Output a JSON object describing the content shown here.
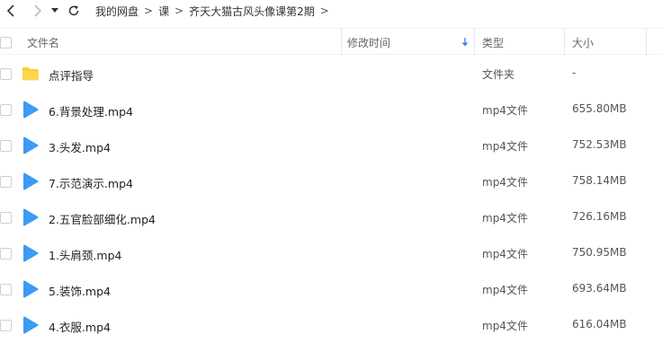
{
  "toolbar": {
    "back_icon": "chevron-left-icon",
    "forward_icon": "chevron-right-icon",
    "dropdown_icon": "caret-down-icon",
    "refresh_icon": "refresh-icon",
    "breadcrumb": [
      "我的网盘",
      "课",
      "齐天大猫古风头像课第2期"
    ]
  },
  "columns": {
    "name": "文件名",
    "modified": "修改时间",
    "type": "类型",
    "size": "大小",
    "sort_icon": "sort-down-arrow-icon"
  },
  "colors": {
    "folder": "#FFC933",
    "video": "#3B9BF5",
    "sort_arrow": "#3B82F6"
  },
  "files": [
    {
      "name": "点评指导",
      "type": "文件夹",
      "size": "-",
      "icon": "folder-icon"
    },
    {
      "name": "6.背景处理.mp4",
      "type": "mp4文件",
      "size": "655.80MB",
      "icon": "video-icon"
    },
    {
      "name": "3.头发.mp4",
      "type": "mp4文件",
      "size": "752.53MB",
      "icon": "video-icon"
    },
    {
      "name": "7.示范演示.mp4",
      "type": "mp4文件",
      "size": "758.14MB",
      "icon": "video-icon"
    },
    {
      "name": "2.五官脸部细化.mp4",
      "type": "mp4文件",
      "size": "726.16MB",
      "icon": "video-icon"
    },
    {
      "name": "1.头肩颈.mp4",
      "type": "mp4文件",
      "size": "750.95MB",
      "icon": "video-icon"
    },
    {
      "name": "5.装饰.mp4",
      "type": "mp4文件",
      "size": "693.64MB",
      "icon": "video-icon"
    },
    {
      "name": "4.衣服.mp4",
      "type": "mp4文件",
      "size": "616.04MB",
      "icon": "video-icon"
    }
  ]
}
